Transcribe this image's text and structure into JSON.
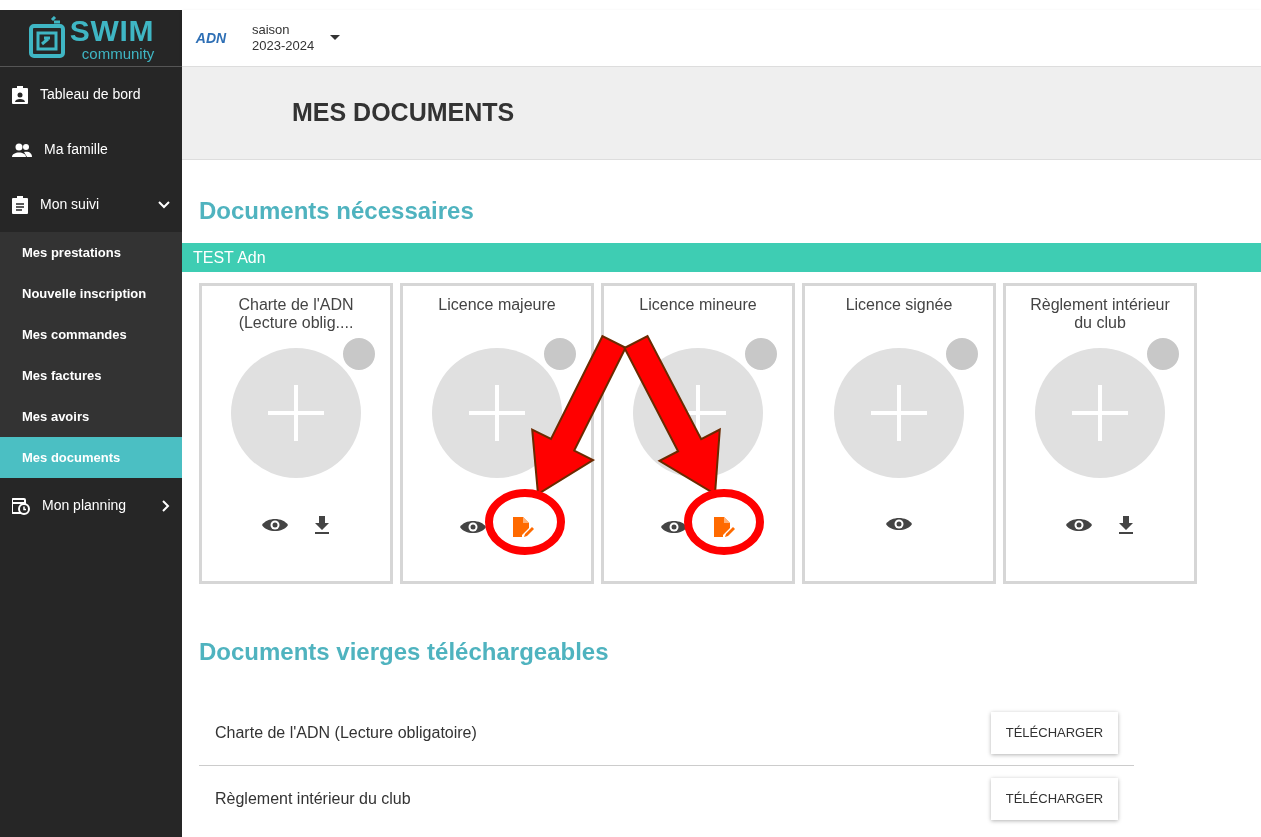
{
  "brand": {
    "name": "SWIM",
    "tagline": "community"
  },
  "header": {
    "club_logo": "ADN",
    "season_label": "saison",
    "season_value": "2023-2024"
  },
  "sidebar": {
    "items": [
      {
        "label": "Tableau de bord",
        "kind": "dashboard",
        "selected": false
      },
      {
        "label": "Ma famille",
        "kind": "family",
        "selected": false
      },
      {
        "label": "Mon suivi",
        "kind": "tracking",
        "selected": false,
        "expanded": true,
        "children": [
          {
            "label": "Mes prestations",
            "selected": false
          },
          {
            "label": "Nouvelle inscription",
            "selected": false
          },
          {
            "label": "Mes commandes",
            "selected": false
          },
          {
            "label": "Mes factures",
            "selected": false
          },
          {
            "label": "Mes avoirs",
            "selected": false
          },
          {
            "label": "Mes documents",
            "selected": true
          }
        ]
      },
      {
        "label": "Mon planning",
        "kind": "planning",
        "selected": false,
        "expanded": false
      }
    ]
  },
  "page_title": "MES DOCUMENTS",
  "required": {
    "title": "Documents nécessaires",
    "group": "TEST Adn",
    "cards": [
      {
        "title": "Charte de l'ADN (Lecture oblig....",
        "actions": [
          {
            "kind": "view"
          },
          {
            "kind": "download"
          }
        ]
      },
      {
        "title": "Licence majeure",
        "actions": [
          {
            "kind": "view"
          },
          {
            "kind": "sign"
          }
        ]
      },
      {
        "title": "Licence mineure",
        "actions": [
          {
            "kind": "view"
          },
          {
            "kind": "sign"
          }
        ]
      },
      {
        "title": "Licence signée",
        "actions": [
          {
            "kind": "view"
          }
        ]
      },
      {
        "title": "Règlement intérieur du club",
        "actions": [
          {
            "kind": "view"
          },
          {
            "kind": "download"
          }
        ]
      }
    ]
  },
  "blank": {
    "title": "Documents vierges téléchargeables",
    "rows": [
      {
        "name": "Charte de l'ADN (Lecture obligatoire)",
        "button": "TÉLÉCHARGER"
      },
      {
        "name": "Règlement intérieur du club",
        "button": "TÉLÉCHARGER"
      }
    ]
  }
}
